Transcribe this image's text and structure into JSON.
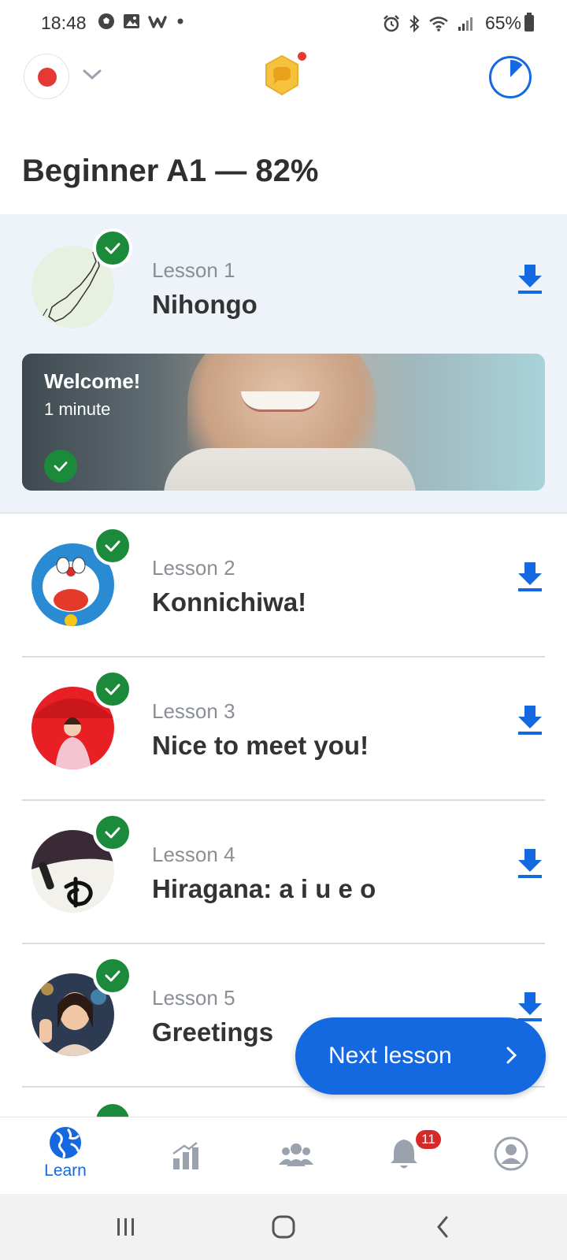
{
  "status_bar": {
    "time": "18:48",
    "battery": "65%",
    "left_icons": [
      "soccer-ball-icon",
      "gallery-icon",
      "w-app-icon",
      "dot-icon"
    ],
    "right_icons": [
      "alarm-icon",
      "bluetooth-icon",
      "wifi-icon",
      "signal-icon",
      "battery-icon"
    ]
  },
  "header": {
    "level_title": "Beginner A1 — 82%",
    "level_progress": 0.82,
    "accent_color": "#1469e0"
  },
  "lessons": [
    {
      "number": "Lesson 1",
      "name": "Nihongo",
      "completed": true,
      "thumb_icon": "japan-map-thumbnail"
    },
    {
      "number": "Lesson 2",
      "name": "Konnichiwa!",
      "completed": true,
      "thumb_icon": "doraemon-thumbnail"
    },
    {
      "number": "Lesson 3",
      "name": "Nice to meet you!",
      "completed": true,
      "thumb_icon": "red-umbrella-kimono-thumbnail"
    },
    {
      "number": "Lesson 4",
      "name": "Hiragana: a i u e o",
      "completed": true,
      "thumb_icon": "calligraphy-thumbnail"
    },
    {
      "number": "Lesson 5",
      "name": "Greetings",
      "completed": true,
      "thumb_icon": "waving-woman-thumbnail"
    }
  ],
  "welcome_card": {
    "title": "Welcome!",
    "duration": "1 minute",
    "completed": true
  },
  "next_button": {
    "label": "Next lesson"
  },
  "bottom_nav": {
    "items": [
      {
        "label": "Learn",
        "icon": "globe-icon",
        "active": true
      },
      {
        "label": "",
        "icon": "bar-chart-icon",
        "active": false
      },
      {
        "label": "",
        "icon": "community-icon",
        "active": false
      },
      {
        "label": "",
        "icon": "bell-icon",
        "active": false
      },
      {
        "label": "",
        "icon": "profile-icon",
        "active": false
      }
    ],
    "notification_count": "11"
  },
  "colors": {
    "check_green": "#1b8a3a",
    "record_red": "#e53935",
    "panel_bg": "#eef3fa",
    "badge_red": "#d42a2a"
  }
}
